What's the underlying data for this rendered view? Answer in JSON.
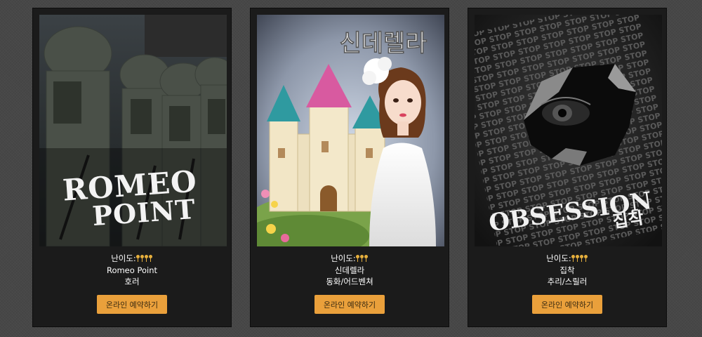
{
  "difficulty_label": "난이도:",
  "rooms": [
    {
      "poster_logo": [
        "ROMEO",
        "POINT"
      ],
      "difficulty_keys": 4,
      "title": "Romeo Point",
      "genre": "호러",
      "button_label": "온라인 예약하기"
    },
    {
      "poster_logo": [
        "신데렐라"
      ],
      "difficulty_keys": 3,
      "title": "신데렐라",
      "genre": "동화/어드벤쳐",
      "button_label": "온라인 예약하기"
    },
    {
      "poster_logo": [
        "OBSESSION",
        "집착"
      ],
      "difficulty_keys": 4,
      "title": "집착",
      "genre": "추리/스릴러",
      "button_label": "온라인 예약하기"
    }
  ],
  "obsession_bg_text": "STOP",
  "colors": {
    "page_bg": "#474747",
    "card_bg": "#1b1b1b",
    "button_bg": "#eaa03b",
    "key_color": "#e7b03d"
  }
}
